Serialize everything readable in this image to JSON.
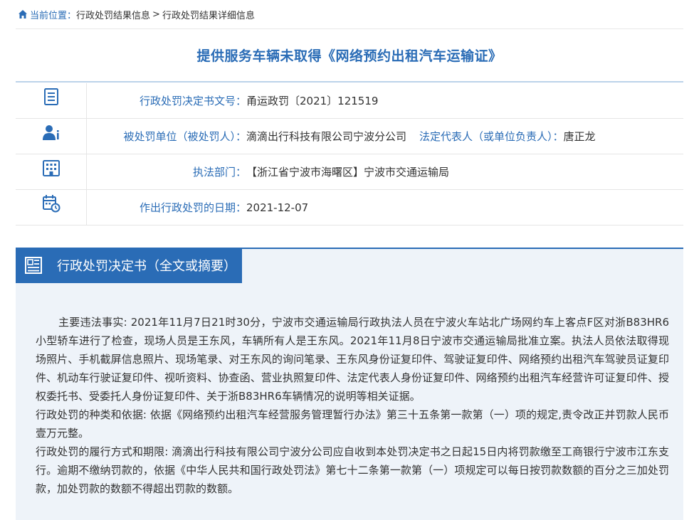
{
  "breadcrumb": {
    "prefix": "当前位置：",
    "item1": "行政处罚结果信息",
    "separator": ">",
    "item2": "行政处罚结果详细信息"
  },
  "page_title": "提供服务车辆未取得《网络预约出租汽车运输证》",
  "info": {
    "decision_no_label": "行政处罚决定书文号：",
    "decision_no_value": "甬运政罚〔2021〕121519",
    "party_label": "被处罚单位（被处罚人）：",
    "party_value": "滴滴出行科技有限公司宁波分公司",
    "legal_rep_label": "法定代表人（或单位负责人）：",
    "legal_rep_value": "唐正龙",
    "dept_label": "执法部门：",
    "dept_value": "【浙江省宁波市海曙区】宁波市交通运输局",
    "date_label": "作出行政处罚的日期：",
    "date_value": "2021-12-07"
  },
  "decision": {
    "header": "行政处罚决定书（全文或摘要）",
    "facts": "主要违法事实: 2021年11月7日21时30分，宁波市交通运输局行政执法人员在宁波火车站北广场网约车上客点F区对浙B83HR6小型轿车进行了检查，现场人员是王东风，车辆所有人是王东风。2021年11月8日宁波市交通运输局批准立案。执法人员依法取得现场照片、手机截屏信息照片、现场笔录、对王东风的询问笔录、王东风身份证复印件、驾驶证复印件、网络预约出租汽车驾驶员证复印件、机动车行驶证复印件、视听资料、协查函、营业执照复印件、法定代表人身份证复印件、网络预约出租汽车经营许可证复印件、授权委托书、受委托人身份证复印件、关于浙B83HR6车辆情况的说明等相关证据。",
    "basis": "行政处罚的种类和依据: 依据《网络预约出租汽车经营服务管理暂行办法》第三十五条第一款第（一）项的规定,责令改正并罚款人民币壹万元整。",
    "performance": "行政处罚的履行方式和期限: 滴滴出行科技有限公司宁波分公司应自收到本处罚决定书之日起15日内将罚款缴至工商银行宁波市江东支行。逾期不缴纳罚款的，依据《中华人民共和国行政处罚法》第七十二条第一款第（一）项规定可以每日按罚款数额的百分之三加处罚款，加处罚款的数额不得超出罚款的数额。"
  },
  "colors": {
    "accent": "#2a6cb6",
    "panel_bg": "#eef3f9"
  },
  "icons": [
    "home-icon",
    "document-number-icon",
    "person-icon",
    "building-icon",
    "calendar-icon",
    "decision-doc-icon"
  ]
}
